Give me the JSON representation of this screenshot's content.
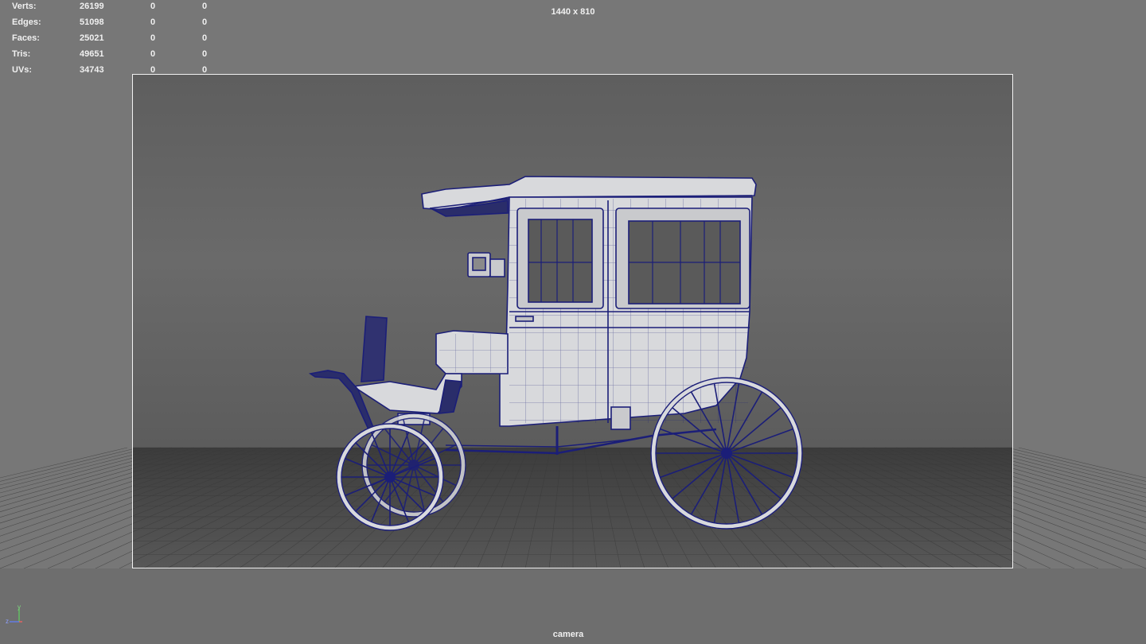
{
  "heads_up_display": {
    "stats": [
      {
        "label": "Verts:",
        "values": [
          "26199",
          "0",
          "0"
        ]
      },
      {
        "label": "Edges:",
        "values": [
          "51098",
          "0",
          "0"
        ]
      },
      {
        "label": "Faces:",
        "values": [
          "25021",
          "0",
          "0"
        ]
      },
      {
        "label": "Tris:",
        "values": [
          "49651",
          "0",
          "0"
        ]
      },
      {
        "label": "UVs:",
        "values": [
          "34743",
          "0",
          "0"
        ]
      }
    ],
    "resolution_label": "1440 x 810",
    "camera_name": "camera"
  },
  "axis_gizmo": {
    "y_label": "y",
    "z_label": "z"
  },
  "colors": {
    "background": "#777777",
    "backdrop": "#606060",
    "floor": "#4a4a4a",
    "wireframe": "#1b1e78",
    "surface": "#d8d9dc",
    "gate_border": "#f2f2f2"
  },
  "scene": {
    "model": "carriage",
    "display_mode": "wireframe-on-shaded"
  }
}
